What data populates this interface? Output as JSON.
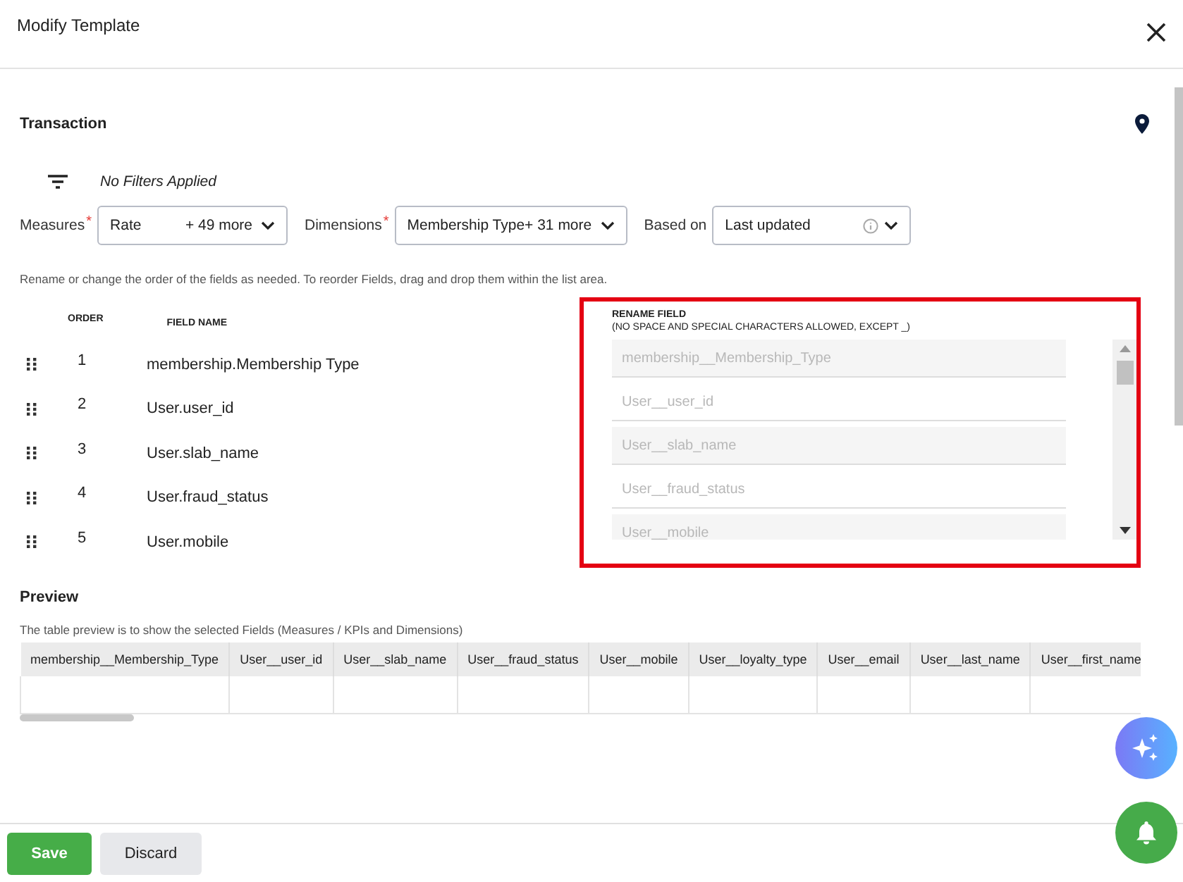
{
  "window": {
    "title": "Modify Template"
  },
  "section_title": "Transaction",
  "filter_status": "No Filters Applied",
  "selectors": [
    {
      "label": "Measures",
      "required_mark": "*",
      "value": "Rate",
      "more": "+ 49 more",
      "info": false
    },
    {
      "label": "Dimensions",
      "required_mark": "*",
      "value": "Membership Type+ 31 more",
      "info": false
    },
    {
      "label": "Based on",
      "value": "Last updated",
      "info": true
    }
  ],
  "instructions": "Rename or change the order of the fields as needed. To reorder Fields, drag and drop them within the list area.",
  "columns": {
    "order": "ORDER",
    "field_name": "FIELD NAME",
    "rename": "RENAME FIELD",
    "rename_hint": "(NO SPACE AND SPECIAL CHARACTERS ALLOWED, EXCEPT _)"
  },
  "fields": [
    {
      "order": "1",
      "name": "membership.Membership Type",
      "placeholder": "membership__Membership_Type"
    },
    {
      "order": "2",
      "name": "User.user_id",
      "placeholder": "User__user_id"
    },
    {
      "order": "3",
      "name": "User.slab_name",
      "placeholder": "User__slab_name"
    },
    {
      "order": "4",
      "name": "User.fraud_status",
      "placeholder": "User__fraud_status"
    },
    {
      "order": "5",
      "name": "User.mobile",
      "placeholder": "User__mobile"
    }
  ],
  "preview": {
    "title": "Preview",
    "description": "The table preview is to show the selected Fields (Measures / KPIs and Dimensions)",
    "columns": [
      "membership__Membership_Type",
      "User__user_id",
      "User__slab_name",
      "User__fraud_status",
      "User__mobile",
      "User__loyalty_type",
      "User__email",
      "User__last_name",
      "User__first_name"
    ]
  },
  "buttons": [
    {
      "label": "Save",
      "kind": "primary"
    },
    {
      "label": "Discard",
      "kind": "secondary"
    }
  ]
}
